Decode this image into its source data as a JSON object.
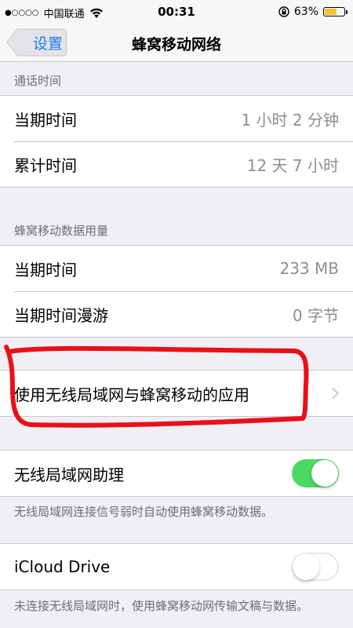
{
  "status_bar": {
    "signal": "●○○○○",
    "carrier": "中国联通",
    "time": "00:31",
    "battery_percent": "63%",
    "battery_level": 0.63
  },
  "nav": {
    "back_label": "设置",
    "title": "蜂窝移动网络"
  },
  "call_time": {
    "header": "通话时间",
    "rows": [
      {
        "label": "当期时间",
        "value": "1 小时 2 分钟"
      },
      {
        "label": "累计时间",
        "value": "12 天 7 小时"
      }
    ]
  },
  "data_usage": {
    "header": "蜂窝移动数据用量",
    "rows": [
      {
        "label": "当期时间",
        "value": "233 MB"
      },
      {
        "label": "当期时间漫游",
        "value": "0 字节"
      }
    ]
  },
  "apps_row": {
    "label": "使用无线局域网与蜂窝移动的应用"
  },
  "wifi_assist": {
    "label": "无线局域网助理",
    "enabled": true,
    "footer": "无线局域网连接信号弱时自动使用蜂窝移动数据。"
  },
  "icloud_drive": {
    "label": "iCloud Drive",
    "enabled": false,
    "footer": "未连接无线局域网时，使用蜂窝移动网传输文稿与数据。"
  },
  "colors": {
    "accent": "#1a7cf5",
    "toggle_on": "#4cd964",
    "annotation": "#e8101a",
    "battery": "#f4c430"
  }
}
